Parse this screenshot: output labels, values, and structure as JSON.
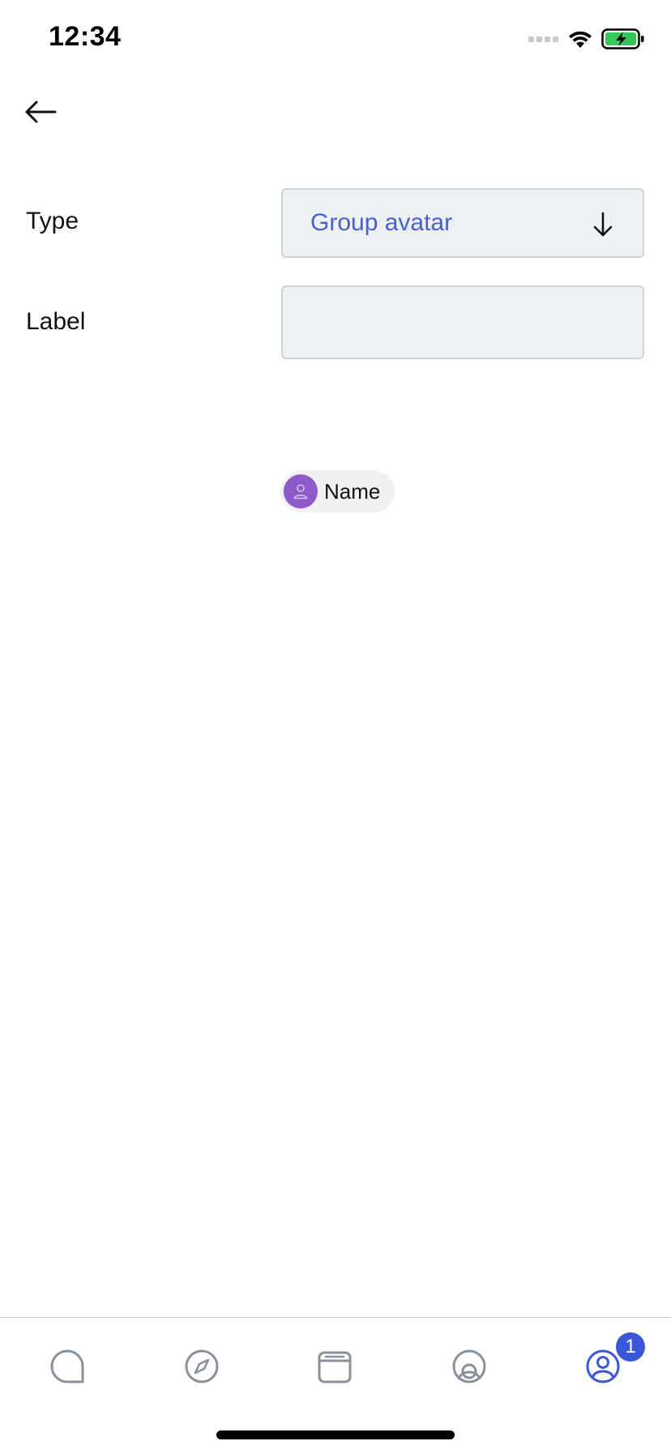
{
  "status_bar": {
    "time": "12:34",
    "battery_color": "#34c759"
  },
  "form": {
    "type": {
      "label": "Type",
      "selected": "Group avatar"
    },
    "label_field": {
      "label": "Label",
      "value": ""
    }
  },
  "preview": {
    "chip_name": "Name",
    "avatar_color": "#8d5bc9"
  },
  "tab_bar": {
    "items": [
      {
        "icon": "chat-bubble-icon",
        "active": false
      },
      {
        "icon": "compass-icon",
        "active": false
      },
      {
        "icon": "inbox-icon",
        "active": false
      },
      {
        "icon": "spaces-icon",
        "active": false
      },
      {
        "icon": "profile-icon",
        "active": true
      }
    ],
    "badge_count": "1",
    "accent_color": "#3a57d6"
  }
}
